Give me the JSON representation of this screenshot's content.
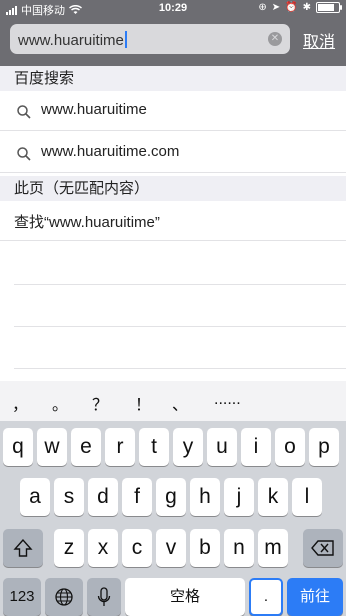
{
  "status": {
    "carrier": "中国移动",
    "time": "10:29"
  },
  "url": {
    "value": "www.huaruitime",
    "cancel_label": "取消"
  },
  "sections": {
    "baidu_header": "百度搜索",
    "baidu_items": [
      "www.huaruitime",
      "www.huaruitime.com"
    ],
    "page_header": "此页（无匹配内容）",
    "find_label": "查找“www.huaruitime”"
  },
  "keyboard": {
    "candidates": [
      "，",
      "。",
      "？",
      "！",
      "、",
      "......"
    ],
    "row1": [
      "q",
      "w",
      "e",
      "r",
      "t",
      "y",
      "u",
      "i",
      "o",
      "p"
    ],
    "row2": [
      "a",
      "s",
      "d",
      "f",
      "g",
      "h",
      "j",
      "k",
      "l"
    ],
    "row3": [
      "z",
      "x",
      "c",
      "v",
      "b",
      "n",
      "m"
    ],
    "num_label": "123",
    "space_label": "空格",
    "dot_label": ".",
    "go_label": "前往"
  }
}
